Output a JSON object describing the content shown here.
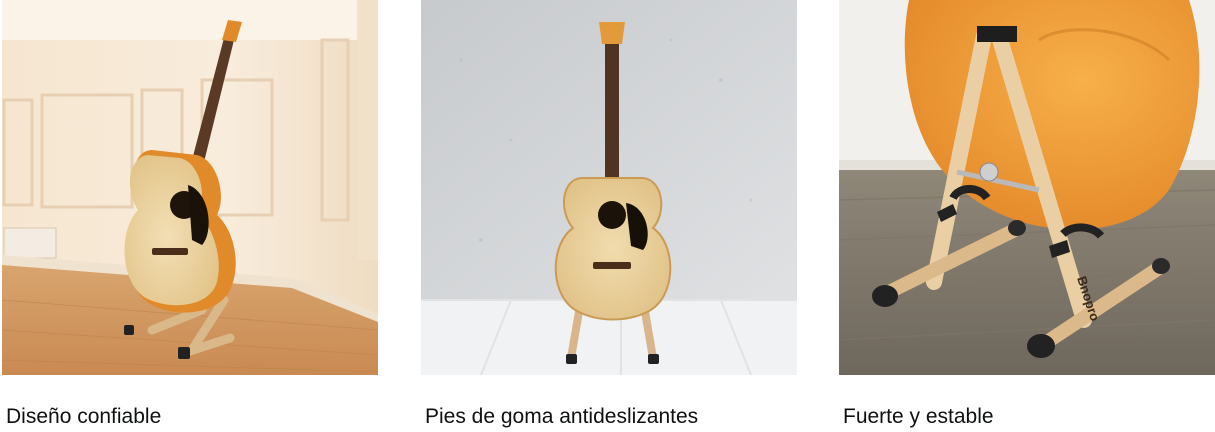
{
  "cards": [
    {
      "caption": "Diseño confiable",
      "image": "guitar-on-stand-in-room-photo"
    },
    {
      "caption": "Pies de goma antideslizantes",
      "image": "guitar-on-stand-against-wall-photo"
    },
    {
      "caption": "Fuerte y estable",
      "image": "stand-closeup-wooden-legs-photo",
      "stand_brand": "Bnopro"
    }
  ],
  "colors": {
    "caption_text": "#0f1111",
    "guitar_top": "#ecd3a0",
    "guitar_side": "#e08a2a",
    "stand_wood": "#e6c99e"
  }
}
